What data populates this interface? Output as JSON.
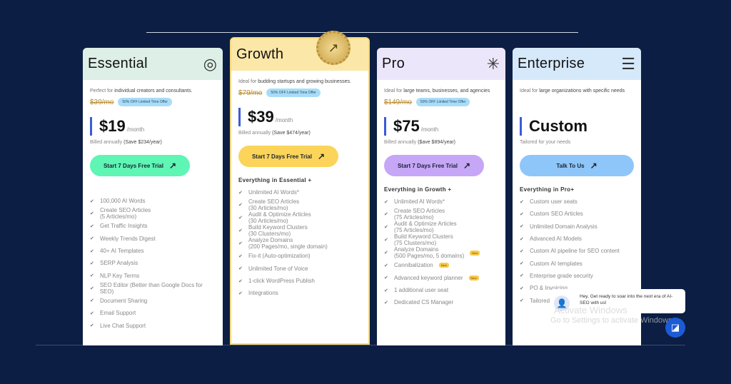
{
  "colors": {
    "background": "#0c1e43",
    "accent_bar": "#3a5bd9"
  },
  "plans": [
    {
      "id": "essential",
      "name": "Essential",
      "icon": "concentric-circles-icon",
      "icon_glyph": "◎",
      "header_color": "#ddefe6",
      "button_color": "#5ff5b5",
      "desc_pre": "Perfect for ",
      "desc_bold": "individual creators and consultants.",
      "original": "$39/mo",
      "badge": "50% OFF Limited Time Offer",
      "price": "$19",
      "per": "/month",
      "billed_pre": "Billed annually ",
      "billed_bold": "(Save $234/year)",
      "button": "Start 7 Days Free Trial",
      "everything": "",
      "features": [
        {
          "t": "100,000 AI Words"
        },
        {
          "t": "Create SEO Articles",
          "s": "(5 Articles/mo)"
        },
        {
          "t": "Get Traffic Insights"
        },
        {
          "t": "Weekly Trends Digest"
        },
        {
          "t": "40+ AI Templates"
        },
        {
          "t": "SERP Analysis"
        },
        {
          "t": "NLP Key Terms"
        },
        {
          "t": "SEO Editor (Better than Google Docs for SEO)"
        },
        {
          "t": "Document Sharing"
        },
        {
          "t": "Email Support"
        },
        {
          "t": "Live Chat Support"
        }
      ]
    },
    {
      "id": "growth",
      "name": "Growth",
      "icon": "",
      "header_color": "#fbe7a8",
      "button_color": "#fcd45a",
      "desc_pre": "Ideal for ",
      "desc_bold": "budding startups and growing businesses.",
      "original": "$79/mo",
      "badge": "50% OFF Limited Time Offer",
      "price": "$39",
      "per": "/month",
      "billed_pre": "Billed annually ",
      "billed_bold": "(Save $474/year)",
      "button": "Start 7 Days Free Trial",
      "everything": "Everything in Essential +",
      "features": [
        {
          "t": "Unlimited AI Words*"
        },
        {
          "t": "Create SEO Articles",
          "s": "(30 Articles/mo)"
        },
        {
          "t": "Audit & Optimize Articles",
          "s": "(30 Articles/mo)"
        },
        {
          "t": "Build Keyword Clusters",
          "s": "(30 Clusters/mo)"
        },
        {
          "t": "Analyze Domains",
          "s": "(200 Pages/mo, single domain)"
        },
        {
          "t": "Fix-it (Auto-optimization)"
        },
        {
          "t": "Unlimited Tone of Voice"
        },
        {
          "t": "1-click WordPress Publish"
        },
        {
          "t": "Integrations"
        }
      ]
    },
    {
      "id": "pro",
      "name": "Pro",
      "icon": "asterisk-icon",
      "icon_glyph": "✳",
      "header_color": "#ece6fb",
      "button_color": "#c6a6f7",
      "desc_pre": "Ideal for ",
      "desc_bold": "large teams, businesses, and agencies",
      "original": "$149/mo",
      "badge": "50% OFF Limited Time Offer",
      "price": "$75",
      "per": "/month",
      "billed_pre": "Billed annually ",
      "billed_bold": "($ave $894/year)",
      "button": "Start 7 Days Free Trial",
      "everything": "Everything in Growth +",
      "features": [
        {
          "t": "Unlimited AI Words*"
        },
        {
          "t": "Create SEO Articles",
          "s": "(75 Articles/mo)"
        },
        {
          "t": "Audit & Optimize Articles",
          "s": "(75 Articles/mo)"
        },
        {
          "t": "Build Keyword Clusters",
          "s": "(75 Clusters/mo)"
        },
        {
          "t": "Analyze Domains",
          "s": "(500 Pages/mo, 5 domains)",
          "new": "New"
        },
        {
          "t": "Cannibalization",
          "new": "New"
        },
        {
          "t": "Advanced keyword planner",
          "new": "New"
        },
        {
          "t": "1 additional user seat"
        },
        {
          "t": "Dedicated CS Manager"
        }
      ]
    },
    {
      "id": "enterprise",
      "name": "Enterprise",
      "icon": "stacked-layers-icon",
      "icon_glyph": "☰",
      "header_color": "#d6e9fb",
      "button_color": "#8ec6f9",
      "desc_pre": "Ideal for ",
      "desc_bold": "large organizations with specific needs",
      "original": "",
      "badge": "",
      "price": "Custom",
      "per": "",
      "billed_pre": "Tailored for your needs",
      "billed_bold": "",
      "button": "Talk To Us",
      "everything": "Everything in Pro+",
      "features": [
        {
          "t": "Custom user seats"
        },
        {
          "t": "Custom SEO Articles"
        },
        {
          "t": "Unlimited Domain Analysis"
        },
        {
          "t": "Advanced AI Models"
        },
        {
          "t": "Custom AI pipeline for SEO content"
        },
        {
          "t": "Custom AI templates"
        },
        {
          "t": "Enterprise grade security"
        },
        {
          "t": "PO & Invoicing"
        },
        {
          "t": "Tailored onboarding"
        }
      ]
    }
  ],
  "seal": {
    "icon": "arrow-up-right-icon"
  },
  "chat": {
    "message": "Hey, Get ready to soar into the next era of AI-SEO with us!"
  },
  "watermark": {
    "line1": "Activate Windows",
    "line2": "Go to Settings to activate Windows."
  }
}
